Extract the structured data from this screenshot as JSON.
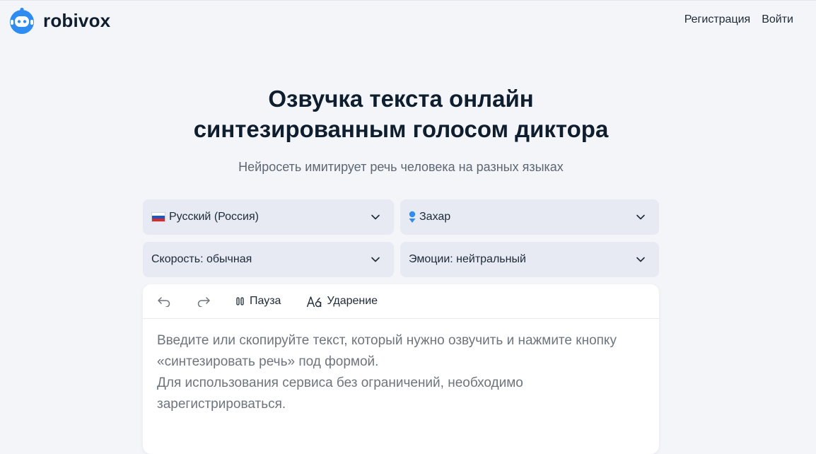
{
  "header": {
    "brand": "robivox",
    "nav": {
      "register": "Регистрация",
      "login": "Войти"
    }
  },
  "hero": {
    "title_line1": "Озвучка текста онлайн",
    "title_line2": "синтезированным голосом диктора",
    "subtitle": "Нейросеть имитирует речь человека на разных языках"
  },
  "controls": {
    "language": {
      "value": "Русский (Россия)",
      "icon": "russia-flag-icon"
    },
    "voice": {
      "value": "Захар",
      "icon": "male-voice-icon"
    },
    "speed": {
      "value": "Скорость: обычная"
    },
    "emotion": {
      "value": "Эмоции: нейтральный"
    }
  },
  "editor": {
    "toolbar": {
      "undo_icon": "undo-icon",
      "redo_icon": "redo-icon",
      "pause_label": "Пауза",
      "stress_label": "Ударение"
    },
    "placeholder_p1": "Введите или скопируйте текст, который нужно озвучить и нажмите кнопку «синтезировать речь» под формой.",
    "placeholder_p2": "Для использования сервиса без ограничений, необходимо зарегистрироваться."
  },
  "colors": {
    "accent": "#2f8cf0",
    "background": "#f4f5f9",
    "select_bg": "#e7eaf2",
    "text_dark": "#0f1e2e",
    "text_muted": "#5c6773"
  }
}
